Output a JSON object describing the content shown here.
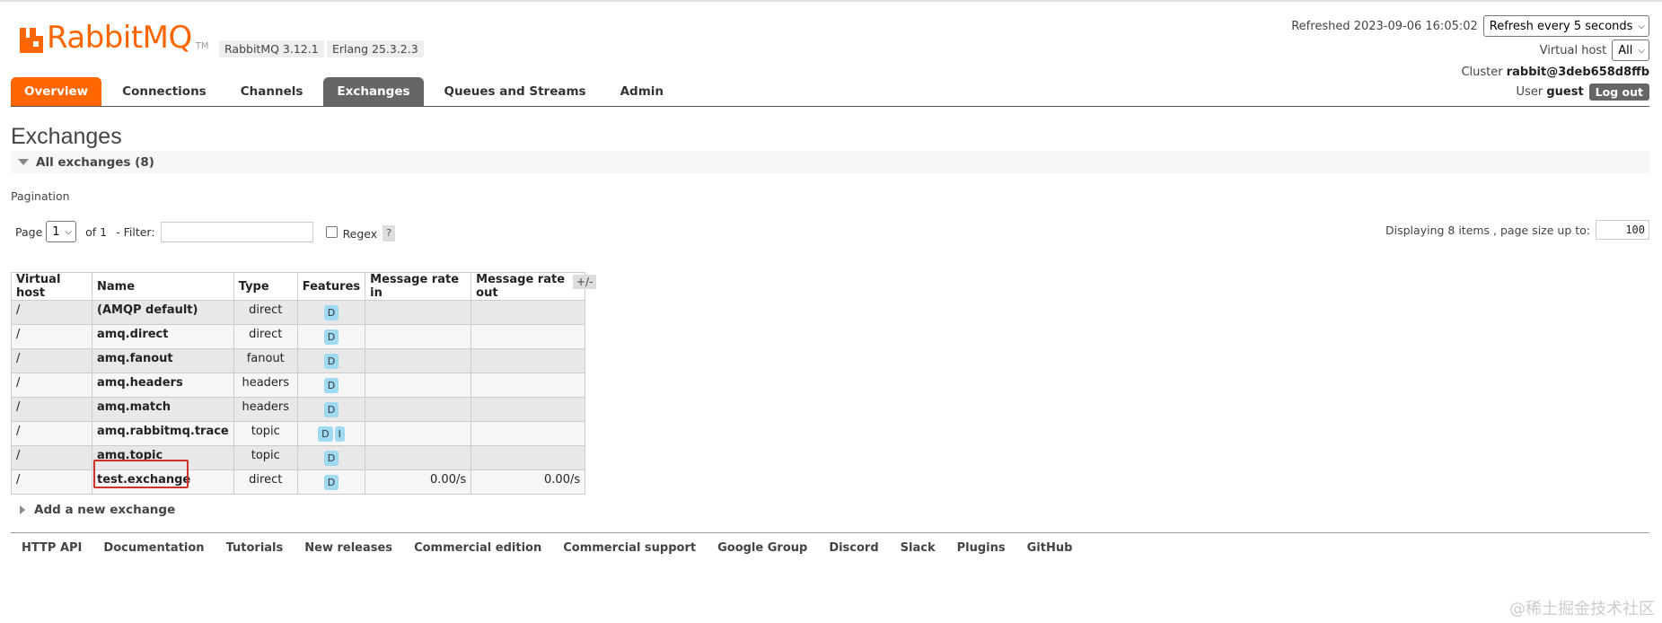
{
  "header": {
    "logo_text": "RabbitMQ",
    "logo_tm": "TM",
    "version": "RabbitMQ 3.12.1",
    "erlang": "Erlang 25.3.2.3",
    "refreshed_label": "Refreshed 2023-09-06 16:05:02",
    "refresh_select": "Refresh every 5 seconds",
    "vhost_label": "Virtual host",
    "vhost_select": "All",
    "cluster_label": "Cluster",
    "cluster_name": "rabbit@3deb658d8ffb",
    "user_label": "User",
    "user_name": "guest",
    "logout_label": "Log out"
  },
  "tabs": [
    {
      "label": "Overview"
    },
    {
      "label": "Connections"
    },
    {
      "label": "Channels"
    },
    {
      "label": "Exchanges"
    },
    {
      "label": "Queues and Streams"
    },
    {
      "label": "Admin"
    }
  ],
  "page": {
    "title": "Exchanges",
    "section_label": "All exchanges (8)",
    "pagination_label": "Pagination",
    "page_label": "Page",
    "page_value": "1",
    "of_label": "of 1",
    "filter_label": "- Filter:",
    "filter_value": "",
    "regex_label": "Regex",
    "help_label": "?",
    "display_info": "Displaying 8 items , page size up to:",
    "page_size": "100",
    "columns_toggle": "+/-",
    "add_new_label": "Add a new exchange"
  },
  "table": {
    "headers": [
      "Virtual host",
      "Name",
      "Type",
      "Features",
      "Message rate in",
      "Message rate out"
    ],
    "rows": [
      {
        "vhost": "/",
        "name": "(AMQP default)",
        "type": "direct",
        "features": [
          "D"
        ],
        "rate_in": "",
        "rate_out": ""
      },
      {
        "vhost": "/",
        "name": "amq.direct",
        "type": "direct",
        "features": [
          "D"
        ],
        "rate_in": "",
        "rate_out": ""
      },
      {
        "vhost": "/",
        "name": "amq.fanout",
        "type": "fanout",
        "features": [
          "D"
        ],
        "rate_in": "",
        "rate_out": ""
      },
      {
        "vhost": "/",
        "name": "amq.headers",
        "type": "headers",
        "features": [
          "D"
        ],
        "rate_in": "",
        "rate_out": ""
      },
      {
        "vhost": "/",
        "name": "amq.match",
        "type": "headers",
        "features": [
          "D"
        ],
        "rate_in": "",
        "rate_out": ""
      },
      {
        "vhost": "/",
        "name": "amq.rabbitmq.trace",
        "type": "topic",
        "features": [
          "D",
          "I"
        ],
        "rate_in": "",
        "rate_out": ""
      },
      {
        "vhost": "/",
        "name": "amq.topic",
        "type": "topic",
        "features": [
          "D"
        ],
        "rate_in": "",
        "rate_out": ""
      },
      {
        "vhost": "/",
        "name": "test.exchange",
        "type": "direct",
        "features": [
          "D"
        ],
        "rate_in": "0.00/s",
        "rate_out": "0.00/s"
      }
    ]
  },
  "footer": {
    "links": [
      "HTTP API",
      "Documentation",
      "Tutorials",
      "New releases",
      "Commercial edition",
      "Commercial support",
      "Google Group",
      "Discord",
      "Slack",
      "Plugins",
      "GitHub"
    ]
  },
  "watermark": "@稀土掘金技术社区",
  "colors": {
    "brand": "#ff6600",
    "active_tab": "#666666",
    "badge": "#9fdaf3",
    "highlight": "#d3302a"
  }
}
